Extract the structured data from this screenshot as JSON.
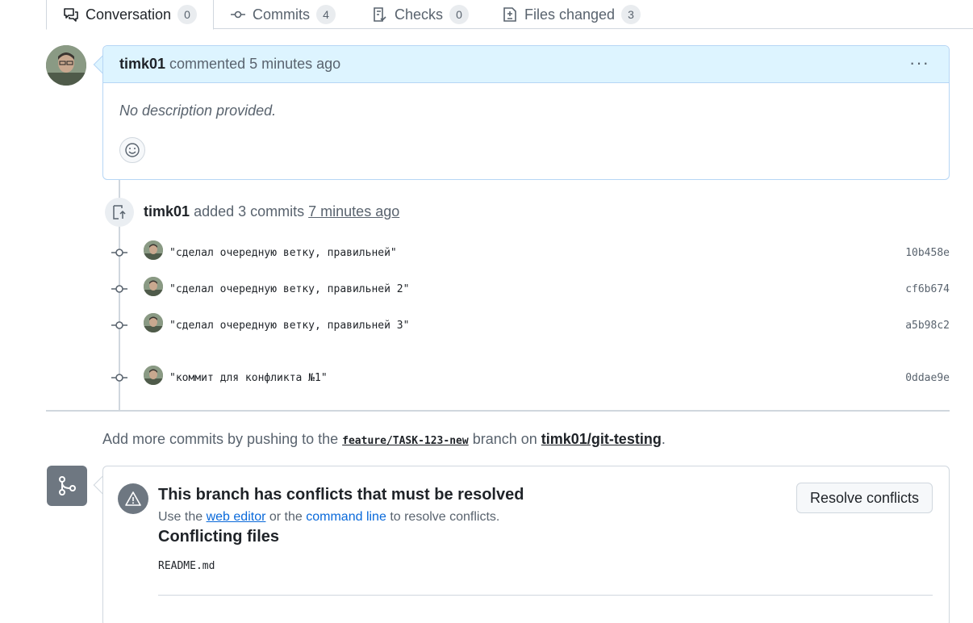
{
  "tabs": [
    {
      "label": "Conversation",
      "count": "0",
      "icon": "comment-discussion-icon"
    },
    {
      "label": "Commits",
      "count": "4",
      "icon": "git-commit-icon"
    },
    {
      "label": "Checks",
      "count": "0",
      "icon": "checklist-icon"
    },
    {
      "label": "Files changed",
      "count": "3",
      "icon": "file-diff-icon"
    }
  ],
  "comment": {
    "author": "timk01",
    "meta": "commented 5 minutes ago",
    "body": "No description provided.",
    "menu": "···"
  },
  "push": {
    "author": "timk01",
    "text": "added 3 commits",
    "time": "7 minutes ago"
  },
  "commits": [
    {
      "message": "\"сделал очередную ветку, правильней\"",
      "sha": "10b458e"
    },
    {
      "message": "\"сделал очередную ветку, правильней 2\"",
      "sha": "cf6b674"
    },
    {
      "message": "\"сделал очередную ветку, правильней 3\"",
      "sha": "a5b98c2"
    },
    {
      "message": "\"коммит для конфликта №1\"",
      "sha": "0ddae9e"
    }
  ],
  "more_commits": {
    "prefix": "Add more commits by pushing to the",
    "branch": "feature/TASK-123-new",
    "middle": "branch on",
    "repo": "timk01/git-testing",
    "suffix": "."
  },
  "conflicts": {
    "title": "This branch has conflicts that must be resolved",
    "sub_prefix": "Use the",
    "web_editor": "web editor",
    "sub_middle": "or the",
    "command_line": "command line",
    "sub_suffix": "to resolve conflicts.",
    "button": "Resolve conflicts",
    "files_title": "Conflicting files",
    "files": [
      "README.md"
    ]
  },
  "colors": {
    "accent": "#0969da",
    "header_bg": "#ddf4ff",
    "border": "#d0d7de",
    "muted": "#59636e"
  }
}
